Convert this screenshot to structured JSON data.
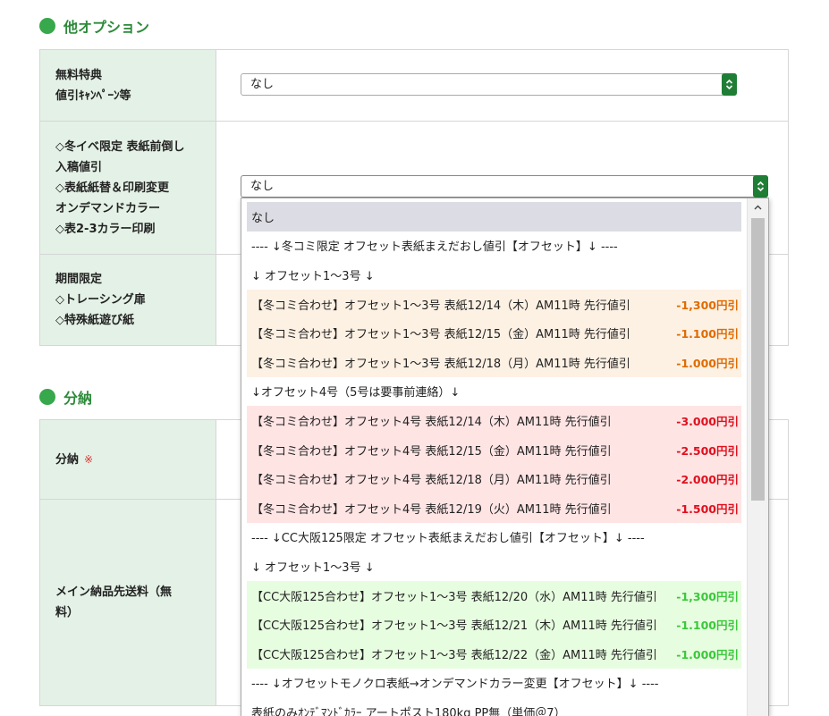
{
  "sections": {
    "other_options": {
      "title": "他オプション"
    },
    "installment": {
      "title": "分納"
    }
  },
  "rows": {
    "free_bonus": {
      "label_line1": "無料特典",
      "label_line2": "値引ｷｬﾝﾍﾟｰﾝ等",
      "select_value": "なし"
    },
    "winter_event": {
      "label_lines": [
        "◇冬イベ限定 表紙前倒し",
        "入稿値引",
        "◇表紙紙替＆印刷変更",
        "オンデマンドカラー",
        "◇表2-3カラー印刷"
      ],
      "select_value": "なし"
    },
    "limited_period": {
      "label_lines": [
        "期間限定",
        "◇トレーシング扉",
        "◇特殊紙遊び紙"
      ]
    },
    "installment": {
      "label": "分納",
      "required_mark": "※"
    },
    "main_delivery": {
      "label_line1": "メイン納品先送料（無",
      "label_line2": "料）"
    }
  },
  "dropdown": {
    "items": [
      {
        "text": "なし",
        "price": "",
        "style": "selected",
        "price_color": ""
      },
      {
        "text": "---- ↓冬コミ限定 オフセット表紙まえだおし値引【オフセット】↓ ----",
        "price": "",
        "style": "plain",
        "price_color": ""
      },
      {
        "text": "↓ オフセット1～3号 ↓",
        "price": "",
        "style": "plain",
        "price_color": ""
      },
      {
        "text": "【冬コミ合わせ】オフセット1～3号 表紙12/14（木）AM11時 先行値引",
        "price": "-1,300円引",
        "style": "beige",
        "price_color": "orange"
      },
      {
        "text": "【冬コミ合わせ】オフセット1～3号 表紙12/15（金）AM11時 先行値引",
        "price": "-1.100円引",
        "style": "beige",
        "price_color": "orange"
      },
      {
        "text": "【冬コミ合わせ】オフセット1～3号 表紙12/18（月）AM11時 先行値引",
        "price": "-1.000円引",
        "style": "beige",
        "price_color": "orange"
      },
      {
        "text": "↓オフセット4号（5号は要事前連絡）↓",
        "price": "",
        "style": "plain",
        "price_color": ""
      },
      {
        "text": "【冬コミ合わせ】オフセット4号 表紙12/14（木）AM11時 先行値引",
        "price": "-3.000円引",
        "style": "pink",
        "price_color": "red"
      },
      {
        "text": "【冬コミ合わせ】オフセット4号 表紙12/15（金）AM11時 先行値引",
        "price": "-2.500円引",
        "style": "pink",
        "price_color": "red"
      },
      {
        "text": "【冬コミ合わせ】オフセット4号 表紙12/18（月）AM11時 先行値引",
        "price": "-2.000円引",
        "style": "pink",
        "price_color": "red"
      },
      {
        "text": "【冬コミ合わせ】オフセット4号 表紙12/19（火）AM11時 先行値引",
        "price": "-1.500円引",
        "style": "pink",
        "price_color": "red"
      },
      {
        "text": "---- ↓CC大阪125限定 オフセット表紙まえだおし値引【オフセット】↓ ----",
        "price": "",
        "style": "plain",
        "price_color": ""
      },
      {
        "text": "↓ オフセット1～3号 ↓",
        "price": "",
        "style": "plain",
        "price_color": ""
      },
      {
        "text": "【CC大阪125合わせ】オフセット1～3号 表紙12/20（水）AM11時 先行値引",
        "price": "-1,300円引",
        "style": "green",
        "price_color": "green"
      },
      {
        "text": "【CC大阪125合わせ】オフセット1～3号 表紙12/21（木）AM11時 先行値引",
        "price": "-1.100円引",
        "style": "green",
        "price_color": "green"
      },
      {
        "text": "【CC大阪125合わせ】オフセット1～3号 表紙12/22（金）AM11時 先行値引",
        "price": "-1.000円引",
        "style": "green",
        "price_color": "green"
      },
      {
        "text": "---- ↓オフセットモノクロ表紙→オンデマンドカラー変更【オフセット】↓ ----",
        "price": "",
        "style": "plain",
        "price_color": ""
      },
      {
        "text": "表紙のみｵﾝﾃﾞﾏﾝﾄﾞｶﾗｰ アートポスト180kg PP無（単価＠7）",
        "price": "",
        "style": "plain",
        "price_color": ""
      }
    ]
  },
  "icons": {
    "select_arrow": "chevron-up-down-icon",
    "scroll_up": "scroll-up-arrow-icon",
    "section_marker": "green-circle-icon"
  },
  "colors": {
    "accent_green": "#2d8a3a",
    "label_bg": "#e4f1e6",
    "select_arrow_bg": "#1f7e35"
  }
}
